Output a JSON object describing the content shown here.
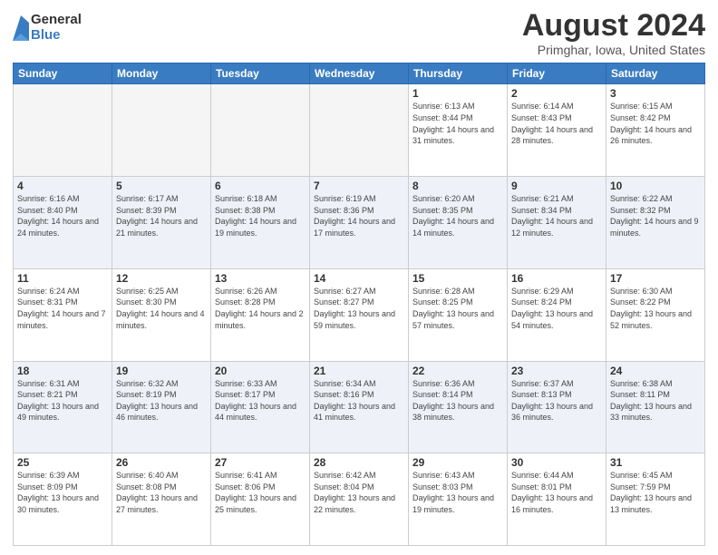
{
  "logo": {
    "general": "General",
    "blue": "Blue"
  },
  "title": "August 2024",
  "subtitle": "Primghar, Iowa, United States",
  "days_of_week": [
    "Sunday",
    "Monday",
    "Tuesday",
    "Wednesday",
    "Thursday",
    "Friday",
    "Saturday"
  ],
  "weeks": [
    [
      {
        "day": "",
        "info": ""
      },
      {
        "day": "",
        "info": ""
      },
      {
        "day": "",
        "info": ""
      },
      {
        "day": "",
        "info": ""
      },
      {
        "day": "1",
        "info": "Sunrise: 6:13 AM\nSunset: 8:44 PM\nDaylight: 14 hours and 31 minutes."
      },
      {
        "day": "2",
        "info": "Sunrise: 6:14 AM\nSunset: 8:43 PM\nDaylight: 14 hours and 28 minutes."
      },
      {
        "day": "3",
        "info": "Sunrise: 6:15 AM\nSunset: 8:42 PM\nDaylight: 14 hours and 26 minutes."
      }
    ],
    [
      {
        "day": "4",
        "info": "Sunrise: 6:16 AM\nSunset: 8:40 PM\nDaylight: 14 hours and 24 minutes."
      },
      {
        "day": "5",
        "info": "Sunrise: 6:17 AM\nSunset: 8:39 PM\nDaylight: 14 hours and 21 minutes."
      },
      {
        "day": "6",
        "info": "Sunrise: 6:18 AM\nSunset: 8:38 PM\nDaylight: 14 hours and 19 minutes."
      },
      {
        "day": "7",
        "info": "Sunrise: 6:19 AM\nSunset: 8:36 PM\nDaylight: 14 hours and 17 minutes."
      },
      {
        "day": "8",
        "info": "Sunrise: 6:20 AM\nSunset: 8:35 PM\nDaylight: 14 hours and 14 minutes."
      },
      {
        "day": "9",
        "info": "Sunrise: 6:21 AM\nSunset: 8:34 PM\nDaylight: 14 hours and 12 minutes."
      },
      {
        "day": "10",
        "info": "Sunrise: 6:22 AM\nSunset: 8:32 PM\nDaylight: 14 hours and 9 minutes."
      }
    ],
    [
      {
        "day": "11",
        "info": "Sunrise: 6:24 AM\nSunset: 8:31 PM\nDaylight: 14 hours and 7 minutes."
      },
      {
        "day": "12",
        "info": "Sunrise: 6:25 AM\nSunset: 8:30 PM\nDaylight: 14 hours and 4 minutes."
      },
      {
        "day": "13",
        "info": "Sunrise: 6:26 AM\nSunset: 8:28 PM\nDaylight: 14 hours and 2 minutes."
      },
      {
        "day": "14",
        "info": "Sunrise: 6:27 AM\nSunset: 8:27 PM\nDaylight: 13 hours and 59 minutes."
      },
      {
        "day": "15",
        "info": "Sunrise: 6:28 AM\nSunset: 8:25 PM\nDaylight: 13 hours and 57 minutes."
      },
      {
        "day": "16",
        "info": "Sunrise: 6:29 AM\nSunset: 8:24 PM\nDaylight: 13 hours and 54 minutes."
      },
      {
        "day": "17",
        "info": "Sunrise: 6:30 AM\nSunset: 8:22 PM\nDaylight: 13 hours and 52 minutes."
      }
    ],
    [
      {
        "day": "18",
        "info": "Sunrise: 6:31 AM\nSunset: 8:21 PM\nDaylight: 13 hours and 49 minutes."
      },
      {
        "day": "19",
        "info": "Sunrise: 6:32 AM\nSunset: 8:19 PM\nDaylight: 13 hours and 46 minutes."
      },
      {
        "day": "20",
        "info": "Sunrise: 6:33 AM\nSunset: 8:17 PM\nDaylight: 13 hours and 44 minutes."
      },
      {
        "day": "21",
        "info": "Sunrise: 6:34 AM\nSunset: 8:16 PM\nDaylight: 13 hours and 41 minutes."
      },
      {
        "day": "22",
        "info": "Sunrise: 6:36 AM\nSunset: 8:14 PM\nDaylight: 13 hours and 38 minutes."
      },
      {
        "day": "23",
        "info": "Sunrise: 6:37 AM\nSunset: 8:13 PM\nDaylight: 13 hours and 36 minutes."
      },
      {
        "day": "24",
        "info": "Sunrise: 6:38 AM\nSunset: 8:11 PM\nDaylight: 13 hours and 33 minutes."
      }
    ],
    [
      {
        "day": "25",
        "info": "Sunrise: 6:39 AM\nSunset: 8:09 PM\nDaylight: 13 hours and 30 minutes."
      },
      {
        "day": "26",
        "info": "Sunrise: 6:40 AM\nSunset: 8:08 PM\nDaylight: 13 hours and 27 minutes."
      },
      {
        "day": "27",
        "info": "Sunrise: 6:41 AM\nSunset: 8:06 PM\nDaylight: 13 hours and 25 minutes."
      },
      {
        "day": "28",
        "info": "Sunrise: 6:42 AM\nSunset: 8:04 PM\nDaylight: 13 hours and 22 minutes."
      },
      {
        "day": "29",
        "info": "Sunrise: 6:43 AM\nSunset: 8:03 PM\nDaylight: 13 hours and 19 minutes."
      },
      {
        "day": "30",
        "info": "Sunrise: 6:44 AM\nSunset: 8:01 PM\nDaylight: 13 hours and 16 minutes."
      },
      {
        "day": "31",
        "info": "Sunrise: 6:45 AM\nSunset: 7:59 PM\nDaylight: 13 hours and 13 minutes."
      }
    ]
  ]
}
